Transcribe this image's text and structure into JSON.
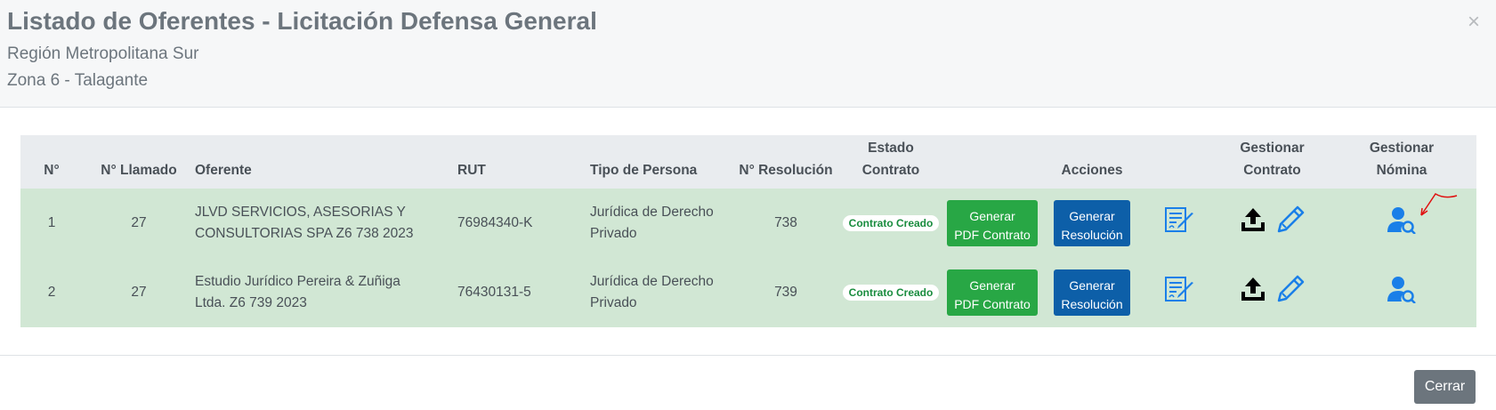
{
  "header": {
    "title": "Listado de Oferentes - Licitación Defensa General",
    "region": "Región Metropolitana Sur",
    "zona": "Zona 6 - Talagante",
    "close_symbol": "×"
  },
  "table": {
    "columns": {
      "num": "N°",
      "llamado": "N° Llamado",
      "oferente": "Oferente",
      "rut": "RUT",
      "tipo": "Tipo de Persona",
      "resolucion": "N° Resolución",
      "estado_line1": "Estado",
      "estado_line2": "Contrato",
      "acciones": "Acciones",
      "gestionar_contrato_line1": "Gestionar",
      "gestionar_contrato_line2": "Contrato",
      "gestionar_nomina_line1": "Gestionar",
      "gestionar_nomina_line2": "Nómina"
    },
    "rows": [
      {
        "num": "1",
        "llamado": "27",
        "oferente": "JLVD SERVICIOS, ASESORIAS Y CONSULTORIAS SPA Z6 738 2023",
        "rut": "76984340-K",
        "tipo": "Jurídica de Derecho Privado",
        "resolucion": "738",
        "estado": "Contrato Creado",
        "btn_pdf_line1": "Generar",
        "btn_pdf_line2": "PDF Contrato",
        "btn_res_line1": "Generar",
        "btn_res_line2": "Resolución"
      },
      {
        "num": "2",
        "llamado": "27",
        "oferente": "Estudio Jurídico Pereira & Zuñiga Ltda. Z6 739 2023",
        "rut": "76430131-5",
        "tipo": "Jurídica de Derecho Privado",
        "resolucion": "739",
        "estado": "Contrato Creado",
        "btn_pdf_line1": "Generar",
        "btn_pdf_line2": "PDF Contrato",
        "btn_res_line1": "Generar",
        "btn_res_line2": "Resolución"
      }
    ]
  },
  "icons": {
    "edit_document": "document-edit-icon",
    "upload": "upload-icon",
    "pencil": "pencil-icon",
    "user_search": "user-search-icon",
    "annotation": "red-arrow-annotation"
  },
  "colors": {
    "row_bg": "#d1e7d4",
    "header_bg": "#e9ecef",
    "btn_green": "#28a745",
    "btn_blue": "#0d5fa8",
    "icon_blue": "#1a7fe8",
    "badge_text": "#198c3e",
    "btn_close": "#6c757d"
  },
  "footer": {
    "close_label": "Cerrar"
  }
}
